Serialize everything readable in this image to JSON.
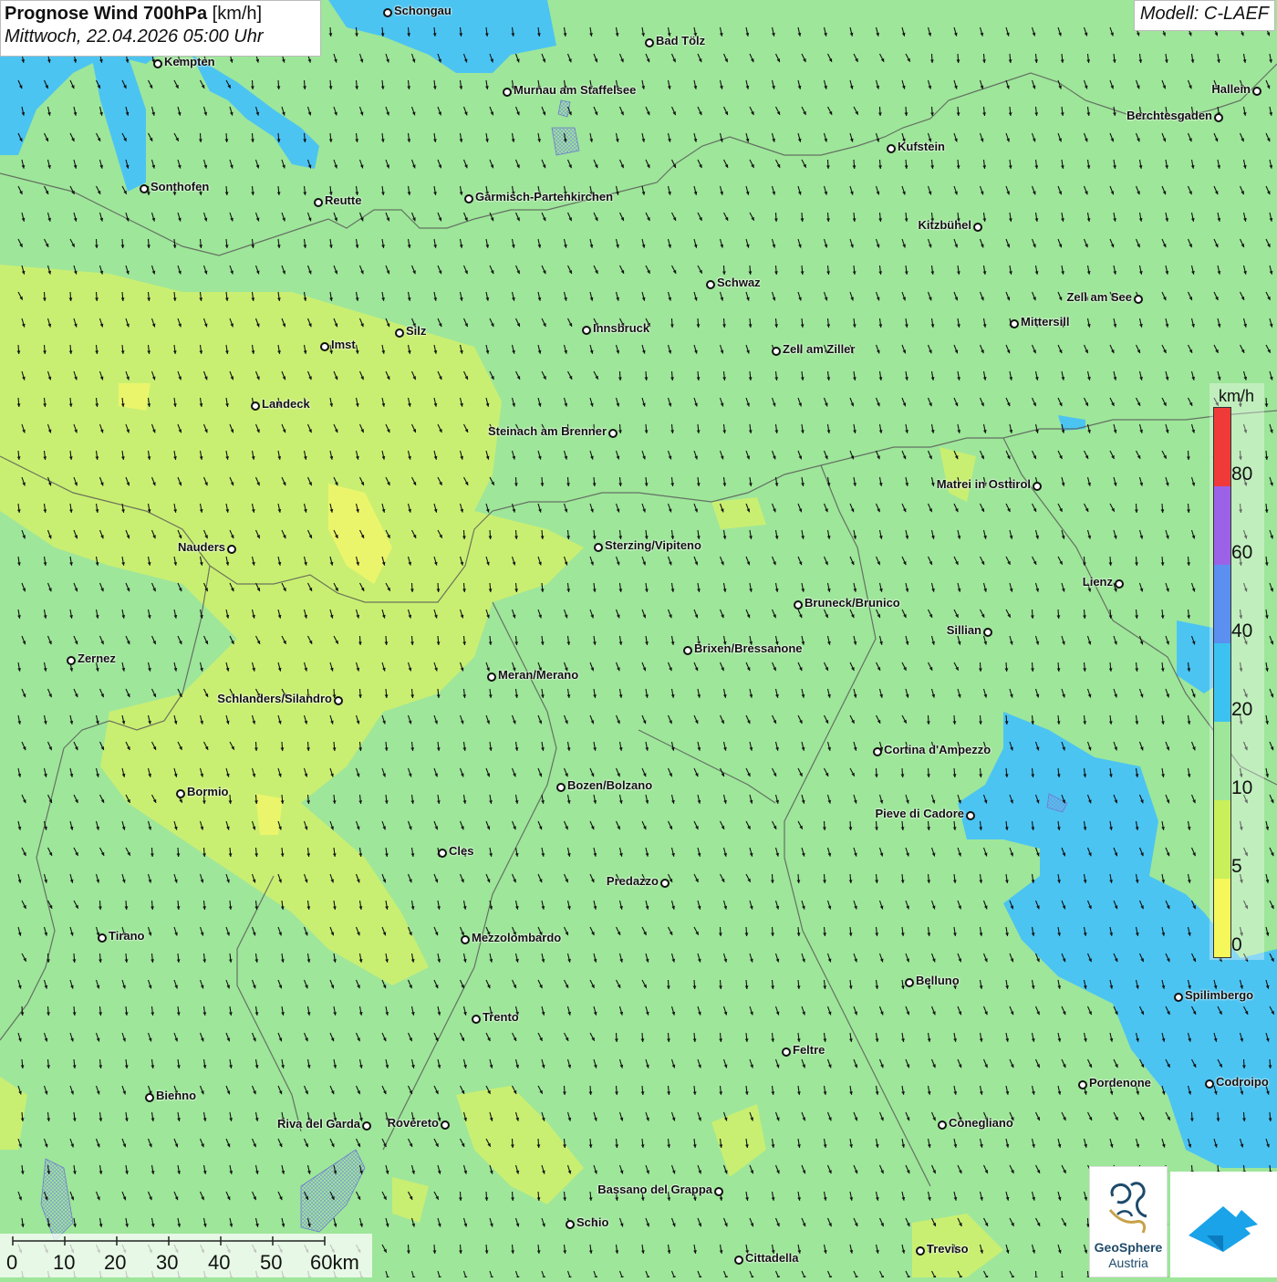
{
  "header": {
    "title_bold": "Prognose Wind 700hPa",
    "title_unit": "[km/h]",
    "datetime": "Mittwoch, 22.04.2026 05:00 Uhr",
    "model": "Modell: C-LAEF"
  },
  "legend": {
    "unit": "km/h",
    "ticks": [
      "0",
      "5",
      "10",
      "20",
      "40",
      "60",
      "80"
    ],
    "colors": [
      "#f6f75a",
      "#c9ef5a",
      "#9ee69a",
      "#3cc2f0",
      "#5b8ff0",
      "#9b62e8",
      "#f03a3a"
    ]
  },
  "scale_bar": {
    "labels": [
      "0",
      "10",
      "20",
      "30",
      "40",
      "50",
      "60km"
    ]
  },
  "logos": {
    "geosphere_line1": "GeoSphere",
    "geosphere_line2": "Austria"
  },
  "cities": [
    {
      "name": "Schongau"
    },
    {
      "name": "Bad Tölz"
    },
    {
      "name": "Kempten"
    },
    {
      "name": "Murnau am Staffelsee"
    },
    {
      "name": "Hallein"
    },
    {
      "name": "Berchtesgaden"
    },
    {
      "name": "Kufstein"
    },
    {
      "name": "Sonthofen"
    },
    {
      "name": "Reutte"
    },
    {
      "name": "Garmisch-Partenkirchen"
    },
    {
      "name": "Kitzbühel"
    },
    {
      "name": "Schwaz"
    },
    {
      "name": "Zell am See"
    },
    {
      "name": "Mittersill"
    },
    {
      "name": "Imst"
    },
    {
      "name": "Silz"
    },
    {
      "name": "Innsbruck"
    },
    {
      "name": "Zell am Ziller"
    },
    {
      "name": "Landeck"
    },
    {
      "name": "Steinach am Brenner"
    },
    {
      "name": "Matrei in Osttirol"
    },
    {
      "name": "Nauders"
    },
    {
      "name": "Sterzing/Vipiteno"
    },
    {
      "name": "Lienz"
    },
    {
      "name": "Bruneck/Brunico"
    },
    {
      "name": "Sillian"
    },
    {
      "name": "Zernez"
    },
    {
      "name": "Brixen/Bressanone"
    },
    {
      "name": "Meran/Merano"
    },
    {
      "name": "Schlanders/Silandro"
    },
    {
      "name": "Cortina d'Ampezzo"
    },
    {
      "name": "Bozen/Bolzano"
    },
    {
      "name": "Bormio"
    },
    {
      "name": "Pieve di Cadore"
    },
    {
      "name": "Cles"
    },
    {
      "name": "Predazzo"
    },
    {
      "name": "Tirano"
    },
    {
      "name": "Mezzolombardo"
    },
    {
      "name": "Belluno"
    },
    {
      "name": "Spilimbergo"
    },
    {
      "name": "Trento"
    },
    {
      "name": "Feltre"
    },
    {
      "name": "Pordenone"
    },
    {
      "name": "Codroipo"
    },
    {
      "name": "Bienno"
    },
    {
      "name": "Riva del Garda"
    },
    {
      "name": "Rovereto"
    },
    {
      "name": "Conegliano"
    },
    {
      "name": "Bassano del Grappa"
    },
    {
      "name": "Schio"
    },
    {
      "name": "Treviso"
    },
    {
      "name": "Cittadella"
    }
  ]
}
